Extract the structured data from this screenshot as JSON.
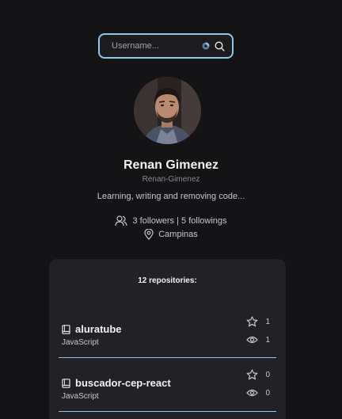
{
  "search": {
    "placeholder": "Username..."
  },
  "profile": {
    "name": "Renan Gimenez",
    "username": "Renan-Gimenez",
    "bio": "Learning, writing and removing code...",
    "followers_text": "3 followers | 5 followings",
    "location": "Campinas"
  },
  "repos": {
    "title": "12 repositories:",
    "items": [
      {
        "name": "aluratube",
        "language": "JavaScript",
        "stars": "1",
        "watchers": "1"
      },
      {
        "name": "buscador-cep-react",
        "language": "JavaScript",
        "stars": "0",
        "watchers": "0"
      }
    ]
  },
  "colors": {
    "background": "#141416",
    "panel": "#222226",
    "accent": "#8fc7e8"
  },
  "icons": {
    "search": "search-icon",
    "extension": "extension-icon",
    "users": "users-icon",
    "location": "map-pin-icon",
    "book": "book-icon",
    "star": "star-icon",
    "eye": "eye-icon"
  }
}
